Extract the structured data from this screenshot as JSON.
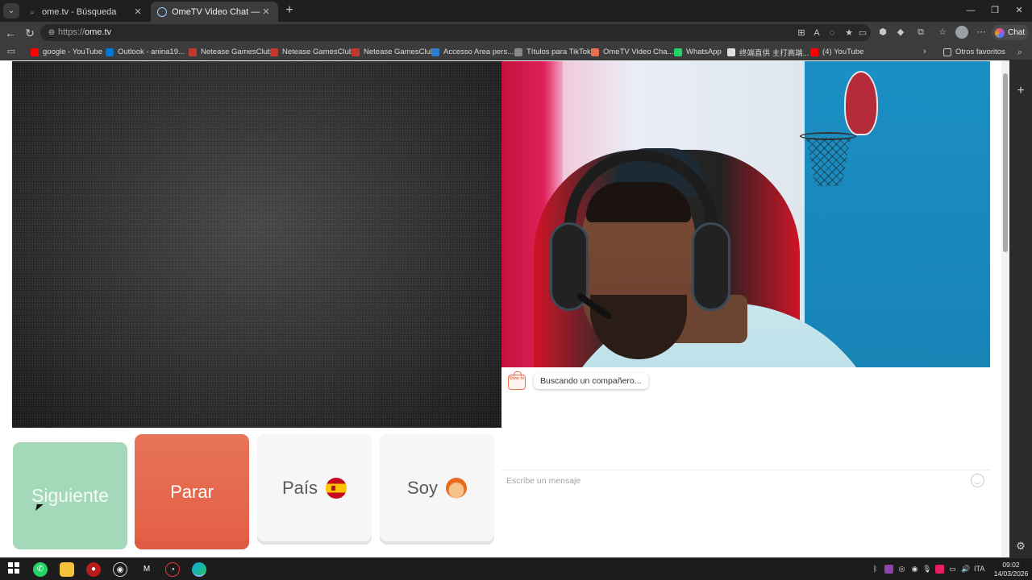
{
  "browser": {
    "tabs": [
      {
        "title": "ome.tv - Búsqueda",
        "active": false
      },
      {
        "title": "OmeTV Video Chat — Omegle",
        "active": true
      }
    ],
    "address_scheme": "https://",
    "address_host": "ome.tv",
    "chat_button": "Chat",
    "bookmarks": [
      {
        "label": "google - YouTube",
        "color": "#ff0000"
      },
      {
        "label": "Outlook - anina19...",
        "color": "#0078d4"
      },
      {
        "label": "Netease GamesClub",
        "color": "#c0392b"
      },
      {
        "label": "Netease GamesClub",
        "color": "#c0392b"
      },
      {
        "label": "Netease GamesClub",
        "color": "#c0392b"
      },
      {
        "label": "Accesso Area pers...",
        "color": "#2d7dd2"
      },
      {
        "label": "Títulos para TikTok",
        "color": "#888888"
      },
      {
        "label": "OmeTV Video Cha...",
        "color": "#e8714d"
      },
      {
        "label": "WhatsApp",
        "color": "#25d366"
      },
      {
        "label": "终端直供 主打高端...",
        "color": "#e0e0e0"
      },
      {
        "label": "(4) YouTube",
        "color": "#ff0000"
      }
    ],
    "other_bookmarks": "Otros favoritos"
  },
  "controls": {
    "next": "Siguiente",
    "stop": "Parar",
    "country": "País",
    "iam": "Soy"
  },
  "chat": {
    "status": "Buscando un compañero...",
    "logo_text": "Ome tv",
    "input_placeholder": "Escribe un mensaje"
  },
  "taskbar": {
    "language": "ITA",
    "time": "09:02",
    "date": "14/03/2026"
  },
  "colors": {
    "next_button": "#a3d9b8",
    "stop_button": "#e35e44",
    "accent": "#e8714d"
  }
}
